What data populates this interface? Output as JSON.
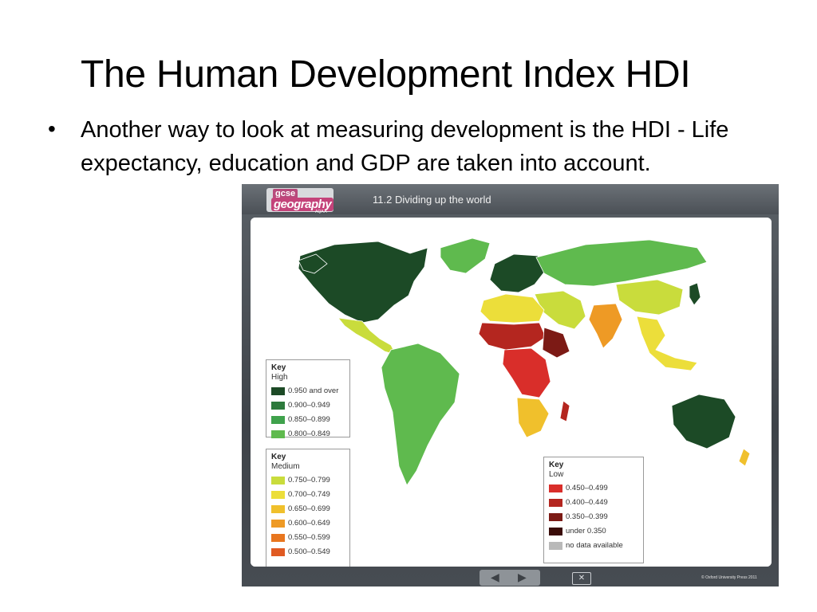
{
  "slide": {
    "title": "The Human Development Index HDI",
    "bullet_dot": "•",
    "bullet": "Another way to look at measuring development is the HDI -  Life expectancy, education and GDP are taken into account."
  },
  "frame": {
    "logo_top": "gcse",
    "logo_main": "geography",
    "logo_sub": "AQA A",
    "title": "11.2 Dividing up the world",
    "prev_icon": "◀",
    "next_icon": "▶",
    "close_icon": "✕",
    "copyright": "© Oxford University Press 2011"
  },
  "map": {
    "ocean_color": "#ffffff",
    "region_color_keys": {
      "north_america": "high_950",
      "mexico_central": "med_750",
      "greenland": "high_800",
      "south_america": "high_800",
      "europe": "high_950",
      "russia": "high_800",
      "middle_east": "med_750",
      "north_africa": "med_700",
      "sahel": "low_400",
      "central_africa": "low_450",
      "east_africa": "low_350",
      "southern_africa": "med_650",
      "india": "med_600",
      "china": "med_750",
      "southeast_asia": "med_700",
      "australia": "high_950",
      "japan": "high_950"
    }
  },
  "legend": {
    "high": {
      "title": "Key",
      "subtitle": "High",
      "items": [
        {
          "label": "0.950 and over",
          "color": "#1c4a26"
        },
        {
          "label": "0.900–0.949",
          "color": "#2d7a3c"
        },
        {
          "label": "0.850–0.899",
          "color": "#3fa24c"
        },
        {
          "label": "0.800–0.849",
          "color": "#5fba4e"
        }
      ]
    },
    "medium": {
      "title": "Key",
      "subtitle": "Medium",
      "items": [
        {
          "label": "0.750–0.799",
          "color": "#c9dc3c"
        },
        {
          "label": "0.700–0.749",
          "color": "#ecde3a"
        },
        {
          "label": "0.650–0.699",
          "color": "#f0c02c"
        },
        {
          "label": "0.600–0.649",
          "color": "#ee9a25"
        },
        {
          "label": "0.550–0.599",
          "color": "#e8761f"
        },
        {
          "label": "0.500–0.549",
          "color": "#e05a22"
        }
      ]
    },
    "low": {
      "title": "Key",
      "subtitle": "Low",
      "items": [
        {
          "label": "0.450–0.499",
          "color": "#d92e2a"
        },
        {
          "label": "0.400–0.449",
          "color": "#b4261f"
        },
        {
          "label": "0.350–0.399",
          "color": "#7c1a15"
        },
        {
          "label": "under 0.350",
          "color": "#3a0c08"
        },
        {
          "label": "no data available",
          "color": "#b9b9b9"
        }
      ]
    }
  }
}
